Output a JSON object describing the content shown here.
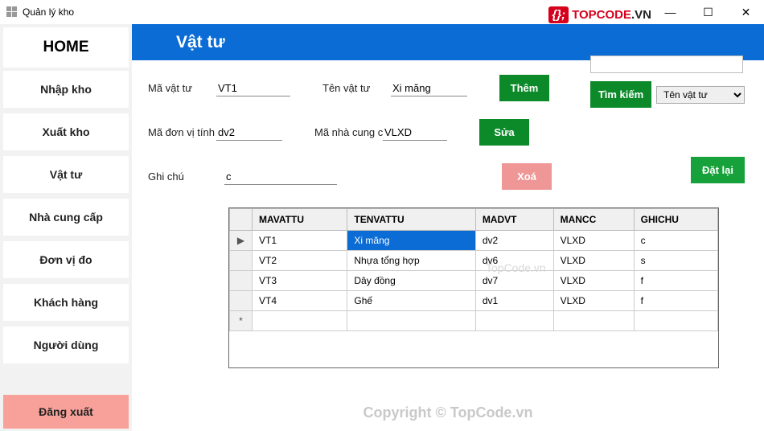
{
  "window": {
    "title": "Quản lý kho"
  },
  "logo": {
    "brand": "TOPCODE",
    "suffix": ".VN",
    "badge": "{};"
  },
  "sidebar": {
    "home": "HOME",
    "items": [
      "Nhập kho",
      "Xuất kho",
      "Vật tư",
      "Nhà cung cấp",
      "Đơn vị đo",
      "Khách hàng",
      "Người dùng"
    ],
    "logout": "Đăng xuất"
  },
  "header": {
    "title": "Vật tư"
  },
  "form": {
    "ma_vat_tu_lbl": "Mã vật tư",
    "ma_vat_tu": "VT1",
    "ten_vat_tu_lbl": "Tên vật tư",
    "ten_vat_tu": "Xi măng",
    "ma_dvt_lbl": "Mã đơn vị tính",
    "ma_dvt": "dv2",
    "ma_ncc_lbl": "Mã nhà cung cấ",
    "ma_ncc": "VLXD",
    "ghi_chu_lbl": "Ghi chú",
    "ghi_chu": "c"
  },
  "buttons": {
    "them": "Thêm",
    "sua": "Sửa",
    "xoa": "Xoá",
    "tim": "Tìm kiếm",
    "reset": "Đặt lại"
  },
  "search": {
    "value": "",
    "filter": "Tên vật tư"
  },
  "grid": {
    "cols": [
      "MAVATTU",
      "TENVATTU",
      "MADVT",
      "MANCC",
      "GHICHU"
    ],
    "rows": [
      {
        "ma": "VT1",
        "ten": "Xi măng",
        "dvt": "dv2",
        "ncc": "VLXD",
        "gc": "c",
        "selected_col": 1
      },
      {
        "ma": "VT2",
        "ten": "Nhựa tổng hợp",
        "dvt": "dv6",
        "ncc": "VLXD",
        "gc": "s"
      },
      {
        "ma": "VT3",
        "ten": "Dây đồng",
        "dvt": "dv7",
        "ncc": "VLXD",
        "gc": "f"
      },
      {
        "ma": "VT4",
        "ten": "Ghế",
        "dvt": "dv1",
        "ncc": "VLXD",
        "gc": "f"
      }
    ],
    "new_row_marker": "*",
    "current_row_marker": "▶"
  },
  "watermark": "Copyright © TopCode.vn",
  "watermark2": "TopCode.vn"
}
